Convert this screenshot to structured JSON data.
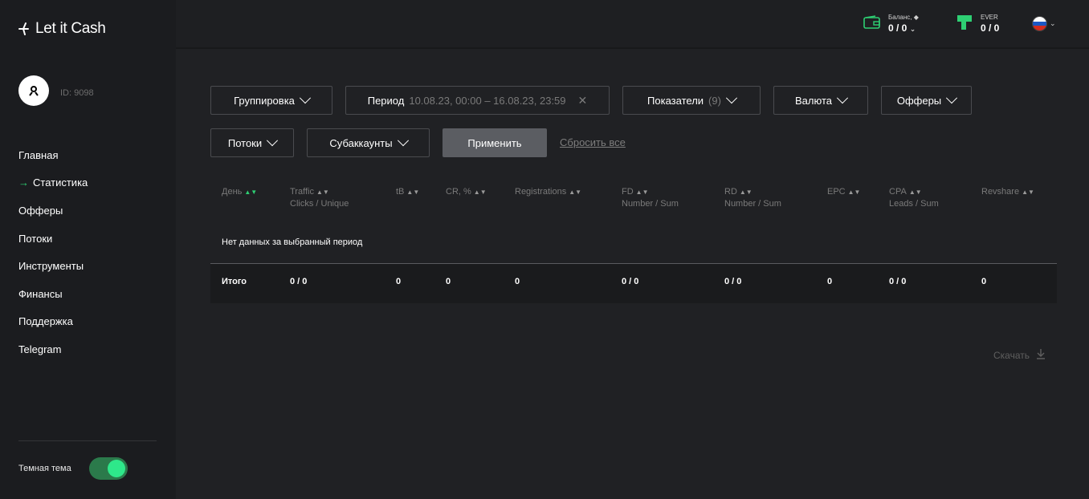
{
  "brand": {
    "name": "Let it Cash"
  },
  "user": {
    "name": "",
    "id": "ID: 9098"
  },
  "nav": [
    {
      "label": "Главная",
      "active": false
    },
    {
      "label": "Статистика",
      "active": true
    },
    {
      "label": "Офферы",
      "active": false
    },
    {
      "label": "Потоки",
      "active": false
    },
    {
      "label": "Инструменты",
      "active": false
    },
    {
      "label": "Финансы",
      "active": false
    },
    {
      "label": "Поддержка",
      "active": false
    },
    {
      "label": "Telegram",
      "active": false
    }
  ],
  "theme": {
    "label": "Темная тема",
    "enabled": true
  },
  "header": {
    "balance": {
      "label": "Баланс,",
      "value": "0 / 0"
    },
    "ever": {
      "label": "EVER",
      "value": "0 / 0"
    },
    "language": "ru"
  },
  "filters": {
    "grouping": "Группировка",
    "period_label": "Период",
    "period_value": "10.08.23, 00:00 – 16.08.23, 23:59",
    "metrics_label": "Показатели",
    "metrics_count": "(9)",
    "currency": "Валюта",
    "offers": "Офферы",
    "streams": "Потоки",
    "subaccounts": "Субаккаунты",
    "apply": "Применить",
    "reset": "Сбросить все"
  },
  "table": {
    "columns": [
      {
        "title": "День",
        "sub": "",
        "sorted": true
      },
      {
        "title": "Traffic",
        "sub": "Clicks / Unique",
        "sorted": false
      },
      {
        "title": "tB",
        "sub": "",
        "sorted": false
      },
      {
        "title": "CR, %",
        "sub": "",
        "sorted": false
      },
      {
        "title": "Registrations",
        "sub": "",
        "sorted": false
      },
      {
        "title": "FD",
        "sub": "Number / Sum",
        "sorted": false
      },
      {
        "title": "RD",
        "sub": "Number / Sum",
        "sorted": false
      },
      {
        "title": "EPC",
        "sub": "",
        "sorted": false
      },
      {
        "title": "CPA",
        "sub": "Leads / Sum",
        "sorted": false
      },
      {
        "title": "Revshare",
        "sub": "",
        "sorted": false
      }
    ],
    "empty_message": "Нет данных за выбранный период",
    "totals": [
      "Итого",
      "0 / 0",
      "0",
      "0",
      "0",
      "0 / 0",
      "0 / 0",
      "0",
      "0 / 0",
      "0"
    ]
  },
  "download": {
    "label": "Скачать"
  },
  "colors": {
    "accent": "#2ecf73",
    "background": "#202124",
    "sidebar": "#1b1c1f"
  }
}
